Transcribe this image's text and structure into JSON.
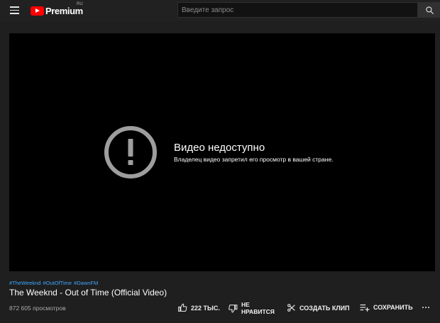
{
  "header": {
    "logo_text": "Premium",
    "logo_region": "RU",
    "search_placeholder": "Введите запрос"
  },
  "player": {
    "error_title": "Видео недоступно",
    "error_message": "Владелец видео запретил его просмотр в вашей стране."
  },
  "video": {
    "hashtags": [
      "#TheWeeknd",
      "#OutOfTime",
      "#DawnFM"
    ],
    "title": "The Weeknd - Out of Time (Official Video)",
    "views": "872 605 просмотров"
  },
  "actions": {
    "like_count": "222 ТЫС.",
    "dislike_line1": "НЕ",
    "dislike_line2": "НРАВИТСЯ",
    "clip_label": "СОЗДАТЬ КЛИП",
    "save_label": "СОХРАНИТЬ"
  },
  "colors": {
    "accent": "#ff0000",
    "hashtag": "#3ea6ff",
    "background": "#1f1f1f",
    "player": "#000000"
  },
  "icons": [
    "menu-icon",
    "youtube-play-icon",
    "search-icon",
    "alert-icon",
    "thumbs-up-icon",
    "thumbs-down-icon",
    "scissors-icon",
    "playlist-add-icon",
    "more-icon"
  ]
}
